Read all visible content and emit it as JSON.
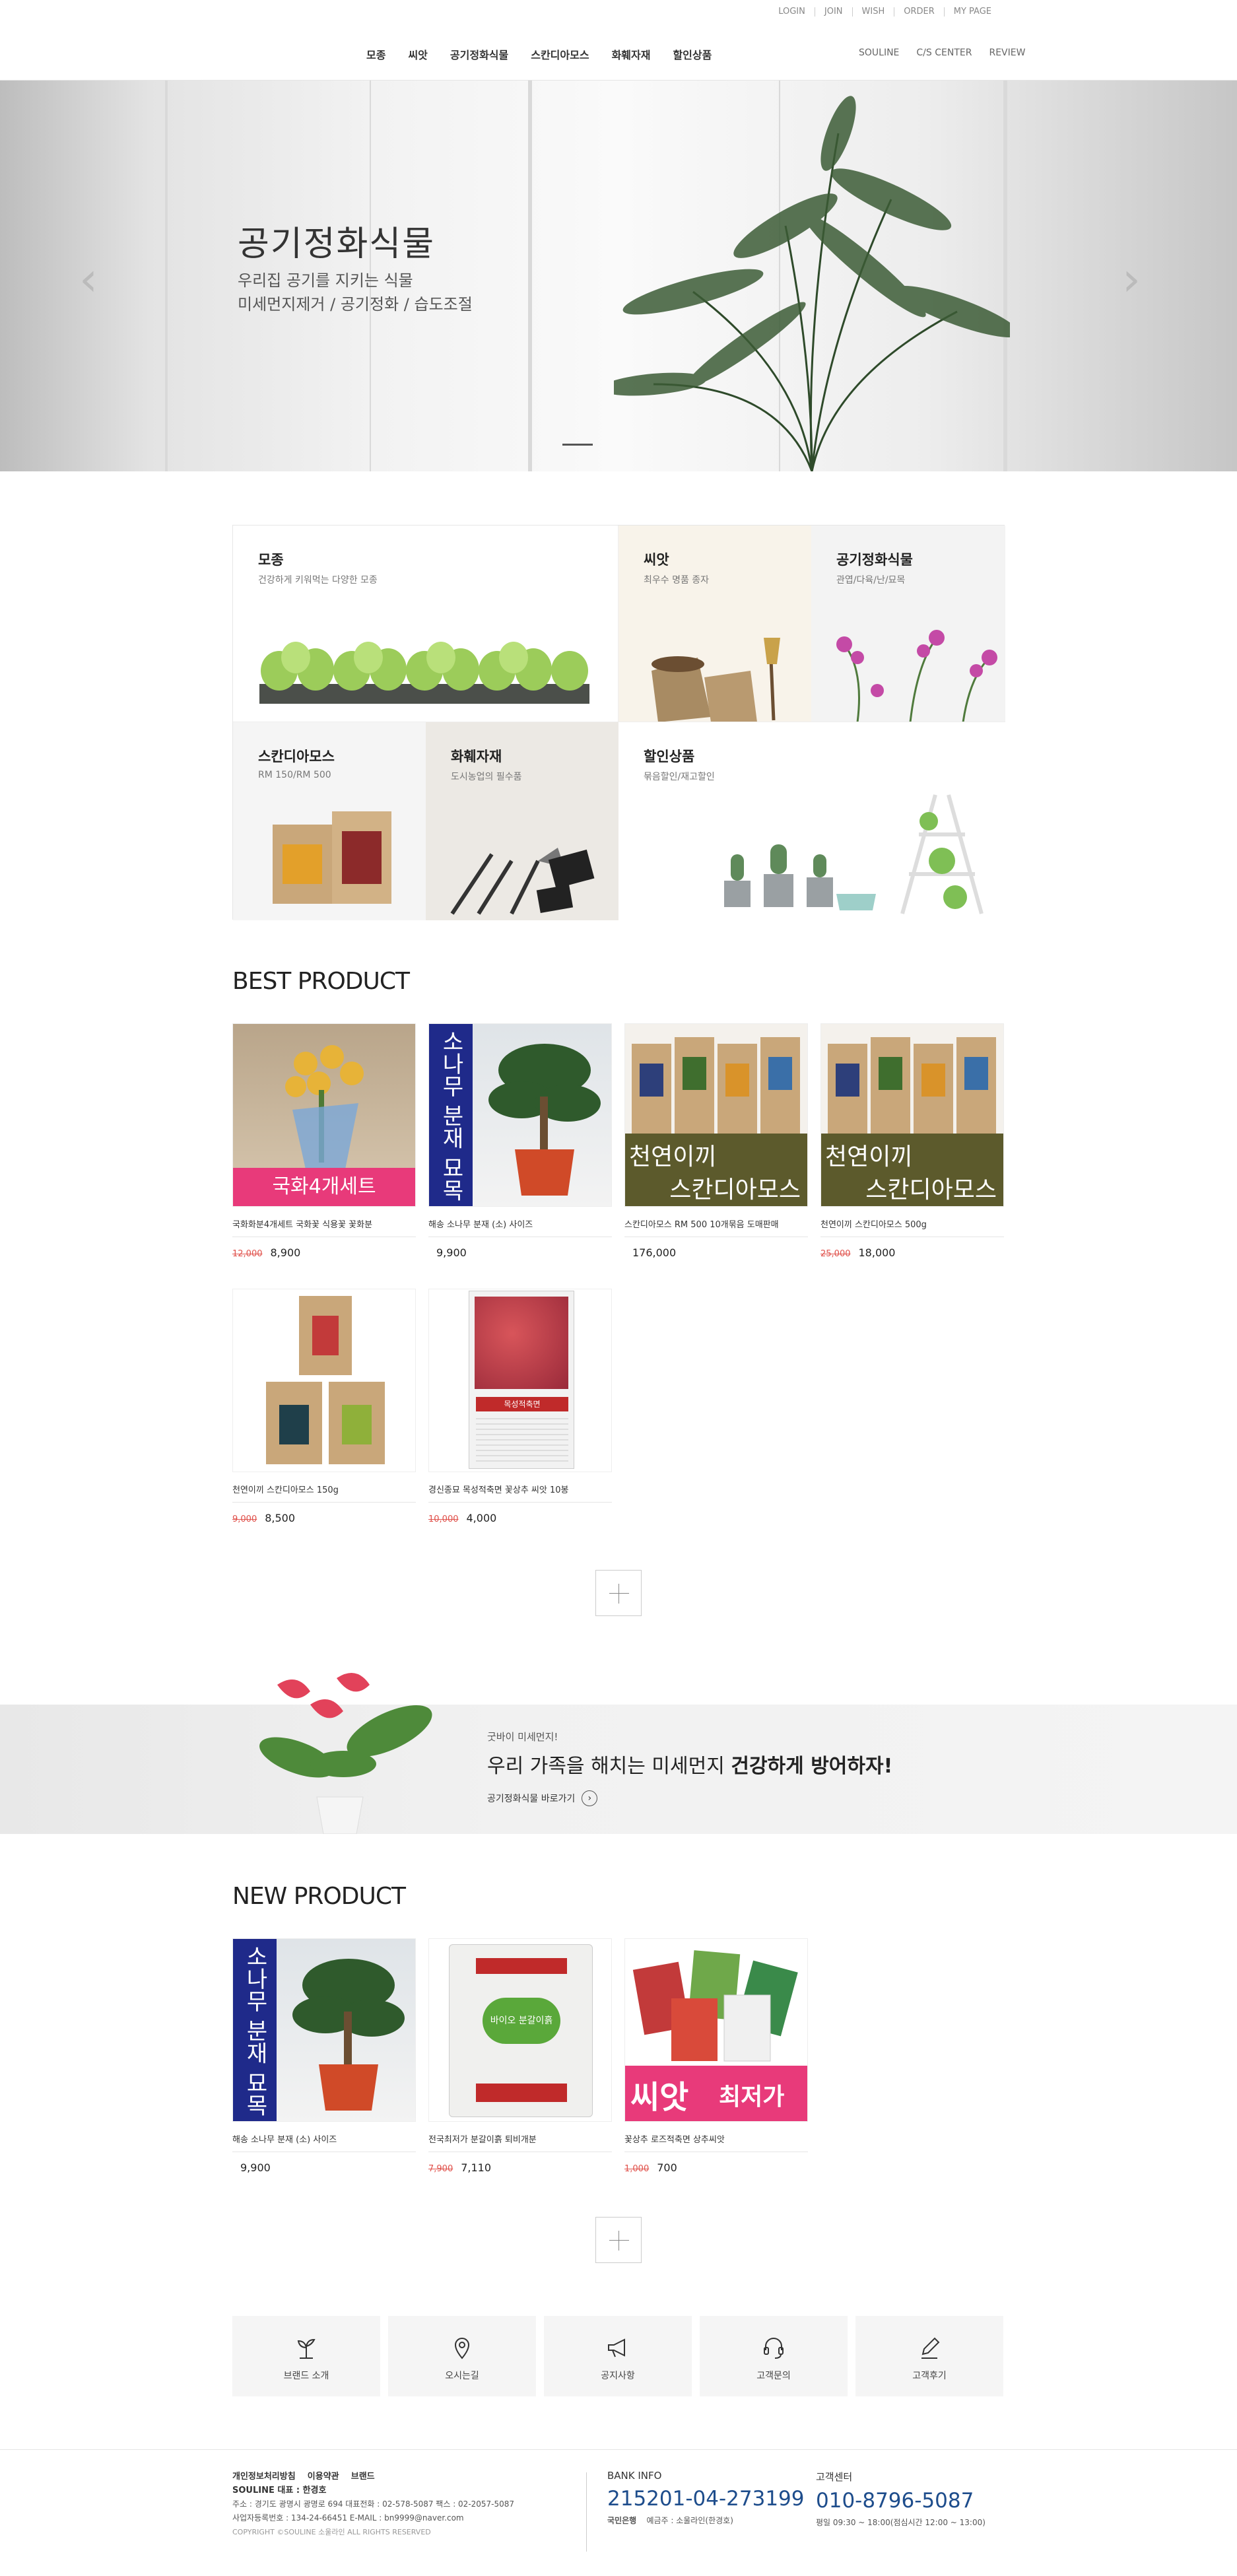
{
  "top_links": [
    "LOGIN",
    "JOIN",
    "WISH",
    "ORDER",
    "MY PAGE"
  ],
  "main_menu": [
    "모종",
    "씨앗",
    "공기정화식물",
    "스칸디아모스",
    "화훼자재",
    "할인상품"
  ],
  "sub_menu": [
    "SOULINE",
    "C/S CENTER",
    "REVIEW"
  ],
  "hero": {
    "title": "공기정화식물",
    "line1": "우리집 공기를 지키는 식물",
    "line2": "미세먼지제거 / 공기정화 / 습도조절",
    "prev": "‹",
    "next": "›"
  },
  "categories": [
    {
      "title": "모종",
      "desc": "건강하게 키워먹는 다양한 모종"
    },
    {
      "title": "씨앗",
      "desc": "최우수 명품 종자"
    },
    {
      "title": "공기정화식물",
      "desc": "관엽/다육/난/묘목"
    },
    {
      "title": "스칸디아모스",
      "desc": "RM 150/RM 500"
    },
    {
      "title": "화훼자재",
      "desc": "도시농업의 필수품"
    },
    {
      "title": "할인상품",
      "desc": "묶음할인/재고할인"
    }
  ],
  "best": {
    "title": "BEST PRODUCT",
    "items": [
      {
        "name": "국화화분4개세트 국화꽃 식용꽃 꽃화분",
        "old": "12,000",
        "price": "8,900",
        "label": "국화4개세트"
      },
      {
        "name": "해송 소나무 분재 (소) 사이즈",
        "old": "",
        "price": "9,900",
        "label": "소나무 분재 묘목"
      },
      {
        "name": "스칸디아모스 RM 500 10개묶음 도매판매",
        "old": "",
        "price": "176,000",
        "label1": "천연이끼",
        "label2": "스칸디아모스"
      },
      {
        "name": "천연이끼 스칸디아모스 500g",
        "old": "25,000",
        "price": "18,000",
        "label1": "천연이끼",
        "label2": "스칸디아모스"
      },
      {
        "name": "천연이끼 스칸디아모스 150g",
        "old": "9,000",
        "price": "8,500"
      },
      {
        "name": "경신종묘 목성적축면 꽃상추 씨앗 10봉",
        "old": "10,000",
        "price": "4,000",
        "label": "목성적축면"
      }
    ]
  },
  "banner": {
    "small": "굿바이 미세먼지!",
    "big_a": "우리 가족을 해치는 미세먼지 ",
    "big_b": "건강하게 방어하자!",
    "link": "공기정화식물 바로가기"
  },
  "newp": {
    "title": "NEW PRODUCT",
    "items": [
      {
        "name": "해송 소나무 분재 (소) 사이즈",
        "old": "",
        "price": "9,900",
        "label": "소나무 분재 묘목"
      },
      {
        "name": "전국최저가 분갈이흙 퇴비개분",
        "old": "7,900",
        "price": "7,110",
        "label": "바이오 분갈이흙"
      },
      {
        "name": "꽃상추 로즈적축면 상추씨앗",
        "old": "1,000",
        "price": "700",
        "label_a": "씨앗",
        "label_b": "최저가"
      }
    ]
  },
  "services": [
    "브랜드 소개",
    "오시는길",
    "공지사항",
    "고객문의",
    "고객후기"
  ],
  "footer": {
    "links": [
      "개인정보처리방침",
      "이용약관",
      "브랜드"
    ],
    "company": "SOULINE  대표 : 한경호",
    "addr": "주소 : 경기도 광명시 광명로 694   대표전화 : 02-578-5087   팩스 : 02-2057-5087",
    "biz": "사업자등록번호 : 134-24-66451   E-MAIL : bn9999@naver.com",
    "copy": "COPYRIGHT ©SOULINE 소울라인 ALL RIGHTS RESERVED",
    "bank_title": "BANK INFO",
    "bank_num": "215201-04-273199",
    "bank_name": "국민은행",
    "bank_owner": "예금주 : 소울라인(한경호)",
    "cs_title": "고객센터",
    "cs_num": "010-8796-5087",
    "cs_hours": "평일 09:30 ~ 18:00(점심시간 12:00 ~ 13:00)"
  },
  "colors": {
    "accent_pink": "#e83a7a",
    "navy_label": "#1f2a8a",
    "olive_label": "#5c5a2c",
    "price_old": "#e0504a",
    "footer_blue": "#1e4d8c"
  }
}
